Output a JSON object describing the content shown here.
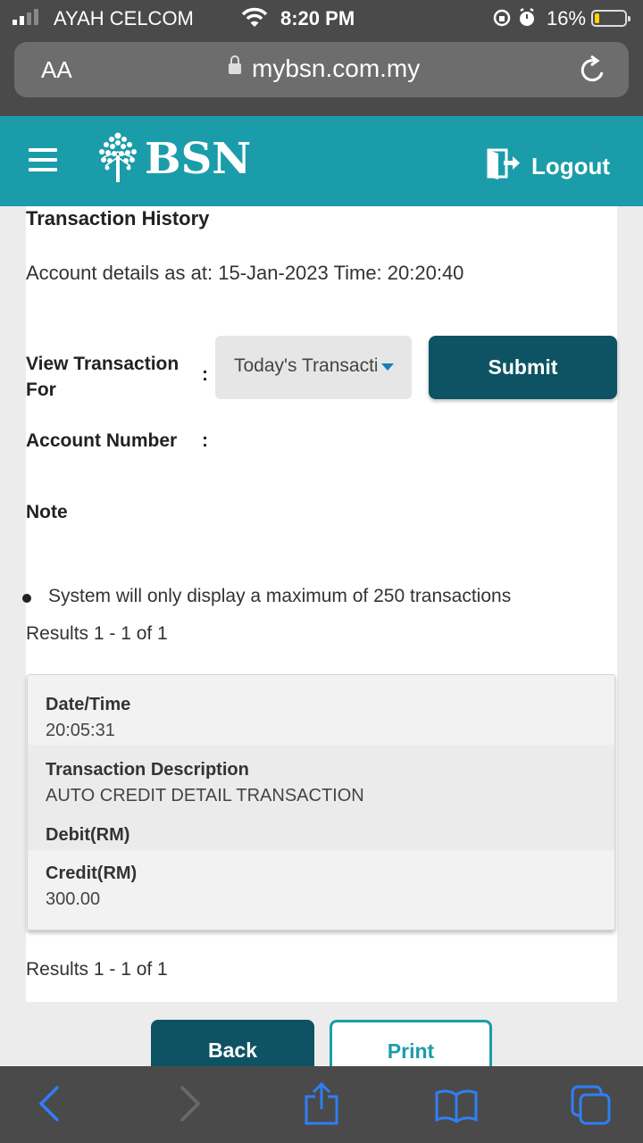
{
  "status_bar": {
    "carrier": "AYAH CELCOM",
    "time": "8:20 PM",
    "battery_percent": "16%",
    "battery_level": 0.16,
    "icons": [
      "signal-icon",
      "wifi-icon",
      "screen-lock-icon",
      "alarm-icon",
      "battery-icon"
    ]
  },
  "browser": {
    "text_size_label": "AA",
    "url": "mybsn.com.my",
    "icons": [
      "lock-icon",
      "reload-icon"
    ]
  },
  "header": {
    "logo_text": "BSN",
    "logout_label": "Logout",
    "icons": [
      "menu-icon",
      "bsn-tree-logo-icon",
      "logout-icon"
    ],
    "brand_color": "#1b9caa"
  },
  "page": {
    "title": "Transaction History",
    "account_details": "Account details as at: 15-Jan-2023 Time: 20:20:40",
    "view_label": "View Transaction For",
    "colon": ":",
    "select_value": "Today's Transactions",
    "submit_label": "Submit",
    "account_number_label": "Account Number",
    "note_label": "Note",
    "note_items": [
      "System will only display a maximum of 250 transactions"
    ],
    "results_text": "Results 1 - 1 of 1",
    "results_text_bottom": "Results 1 - 1 of 1"
  },
  "transaction": {
    "datetime_label": "Date/Time",
    "datetime_value": "20:05:31",
    "description_label": "Transaction Description",
    "description_value": "AUTO CREDIT DETAIL TRANSACTION",
    "debit_label": "Debit(RM)",
    "credit_label": "Credit(RM)",
    "credit_value": "300.00"
  },
  "actions": {
    "back_label": "Back",
    "print_label": "Print",
    "primary_color": "#0e5363"
  },
  "toolbar": {
    "icons": [
      "back-arrow-icon",
      "forward-arrow-icon",
      "share-icon",
      "bookmarks-icon",
      "tabs-icon"
    ],
    "active_color": "#2f7ff5"
  }
}
